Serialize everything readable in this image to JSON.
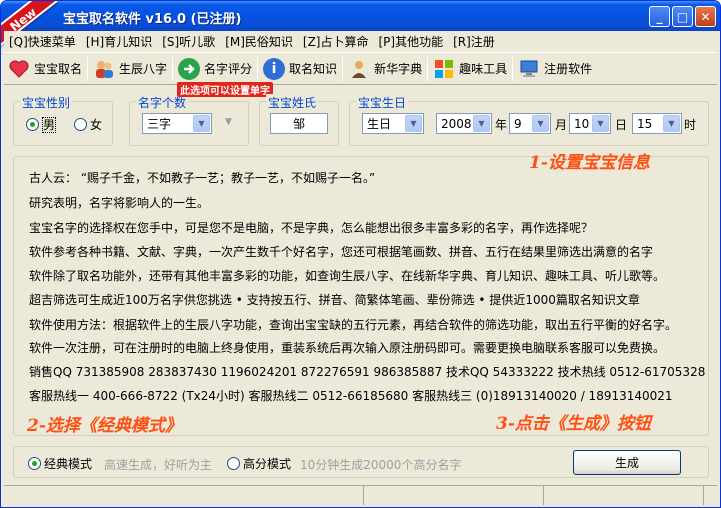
{
  "window": {
    "title": "宝宝取名软件 v16.0 (已注册)",
    "ribbon": "New",
    "controls": {
      "minimize": "_",
      "maximize": "□",
      "close": "✕"
    }
  },
  "menu": [
    "[Q]快速菜单",
    "[H]育儿知识",
    "[S]听儿歌",
    "[M]民俗知识",
    "[Z]占卜算命",
    "[P]其他功能",
    "[R]注册"
  ],
  "toolbar": {
    "items": [
      {
        "label": "宝宝取名",
        "icon": "heart-icon"
      },
      {
        "label": "生辰八字",
        "icon": "people-icon"
      },
      {
        "label": "名字评分",
        "icon": "arrow-right-icon"
      },
      {
        "label": "取名知识",
        "icon": "info-icon"
      },
      {
        "label": "新华字典",
        "icon": "person-book-icon"
      },
      {
        "label": "趣味工具",
        "icon": "windows-logo-icon"
      },
      {
        "label": "注册软件",
        "icon": "monitor-icon"
      }
    ]
  },
  "form": {
    "gender": {
      "label": "宝宝性别",
      "options": [
        "男",
        "女"
      ],
      "selected": "男"
    },
    "name_length": {
      "label": "名字个数",
      "value": "三字",
      "hint": "此选项可以设置单字"
    },
    "surname": {
      "label": "宝宝姓氏",
      "value": "邹"
    },
    "birthday": {
      "label": "宝宝生日",
      "calendar": "生日",
      "year": "2008",
      "year_unit": "年",
      "month": "9",
      "month_unit": "月",
      "day": "10",
      "day_unit": "日",
      "hour": "15",
      "hour_unit": "时"
    }
  },
  "info_lines": [
    "古人云：  “赐子千金，不如教子一艺；教子一艺，不如赐子一名。”",
    "研究表明，名字将影响人的一生。",
    "宝宝名字的选择权在您手中，可是您不是电脑，不是字典，怎么能想出很多丰富多彩的名字，再作选择呢？",
    "软件参考各种书籍、文献、字典，一次产生数千个好名字，您还可根据笔画数、拼音、五行在结果里筛选出满意的名字",
    "软件除了取名功能外，还带有其他丰富多彩的功能，如查询生辰八字、在线新华字典、育儿知识、趣味工具、听儿歌等。",
    "超吉筛选可生成近100万名字供您挑选   •  支持按五行、拼音、简繁体笔画、辈份筛选  •  提供近1000篇取名知识文章",
    "软件使用方法：根据软件上的生辰八字功能，查询出宝宝缺的五行元素，再结合软件的筛选功能，取出五行平衡的好名字。",
    "软件一次注册，可在注册时的电脑上终身使用，重装系统后再次输入原注册码即可。需要更换电脑联系客服可以免费换。",
    "销售QQ 731385908   283837430   1196024201   872276591   986385887    技术QQ 54333222   技术热线 0512-61705328",
    "客服热线一 400-666-8722 (Tx24小时)   客服热线二 0512-66185680     客服热线三 (0)18913140020 / 18913140021"
  ],
  "hints": {
    "step1": "1-设置宝宝信息",
    "step2": "2-选择《经典模式》",
    "step3": "3-点击《生成》按钮"
  },
  "mode": {
    "classic": {
      "label": "经典模式",
      "desc": "高速生成，好听为主"
    },
    "high": {
      "label": "高分模式",
      "desc": "10分钟生成20000个高分名字"
    },
    "selected": "classic"
  },
  "generate_button": "生成",
  "colors": {
    "title_blue": "#0553e2",
    "accent": "#ff4f12",
    "group_label": "#0046d5"
  }
}
